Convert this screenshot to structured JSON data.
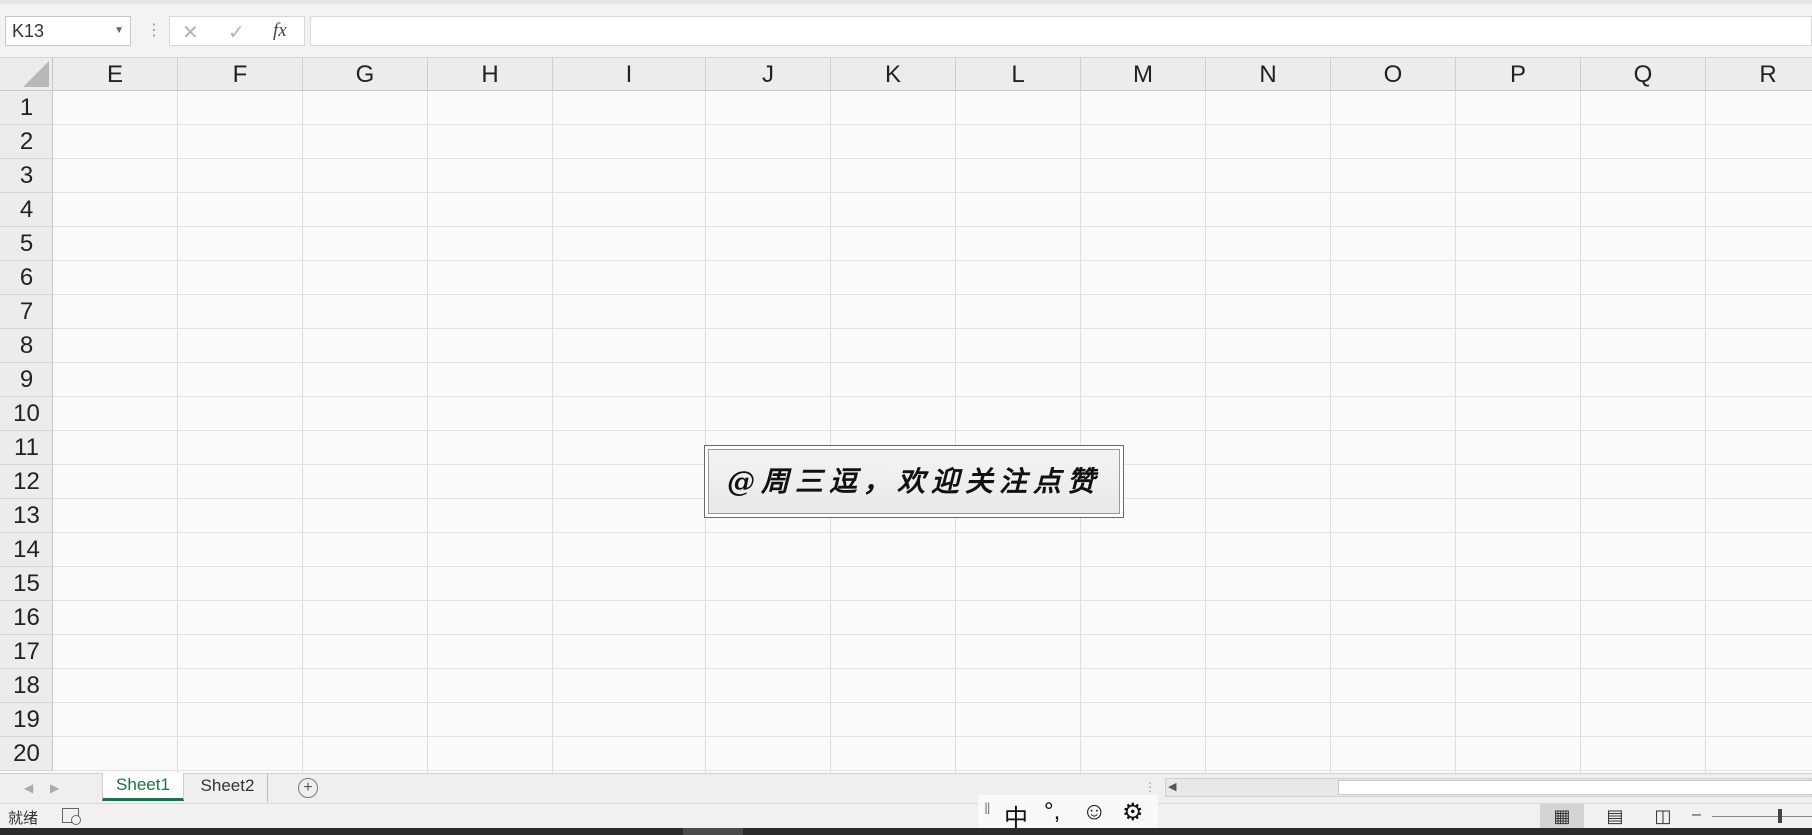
{
  "formula_bar": {
    "name_box": "K13",
    "cancel_icon": "✕",
    "enter_icon": "✓",
    "fx_label": "fx",
    "formula": ""
  },
  "columns": [
    "E",
    "F",
    "G",
    "H",
    "I",
    "J",
    "K",
    "L",
    "M",
    "N",
    "O",
    "P",
    "Q",
    "R"
  ],
  "rows": [
    "1",
    "2",
    "3",
    "4",
    "5",
    "6",
    "7",
    "8",
    "9",
    "10",
    "11",
    "12",
    "13",
    "14",
    "15",
    "16",
    "17",
    "18",
    "19",
    "20"
  ],
  "banner": {
    "text": "@周三逗，欢迎关注点赞"
  },
  "sheet_tabs": {
    "tabs": [
      "Sheet1",
      "Sheet2"
    ],
    "active": "Sheet1",
    "add_icon": "+"
  },
  "status_bar": {
    "ready": "就绪",
    "ime": {
      "chinese": "中",
      "punct": "°,",
      "emoji": "☺",
      "settings": "⚙"
    },
    "zoom_minus": "–"
  },
  "colors": {
    "accent": "#1e7145",
    "grid_line": "#dedede",
    "header_bg": "#ececec"
  }
}
